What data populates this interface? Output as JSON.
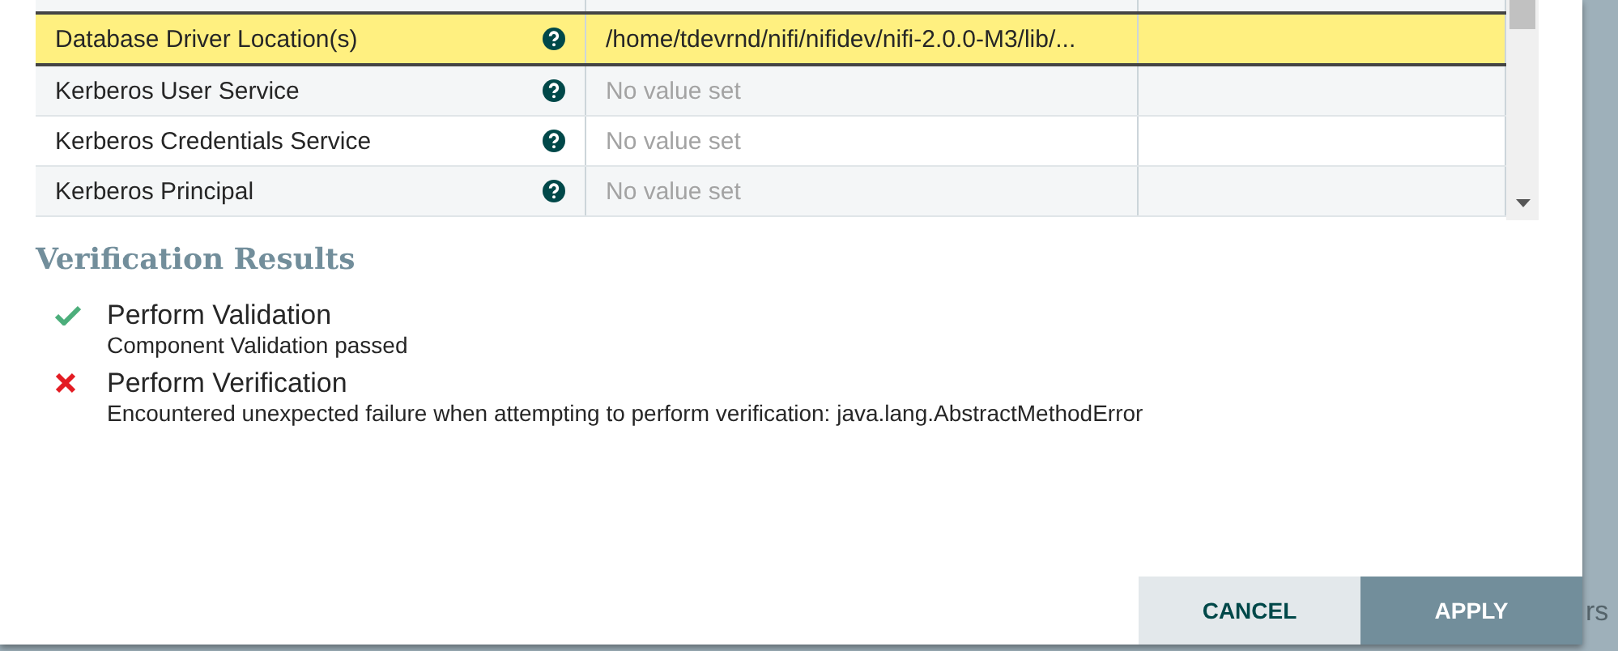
{
  "properties": {
    "rows": [
      {
        "name": "Database Driver Location(s)",
        "value": "/home/tdevrnd/nifi/nifidev/nifi-2.0.0-M3/lib/...",
        "value_set": true,
        "selected": true
      },
      {
        "name": "Kerberos User Service",
        "value": "No value set",
        "value_set": false,
        "selected": false
      },
      {
        "name": "Kerberos Credentials Service",
        "value": "No value set",
        "value_set": false,
        "selected": false
      },
      {
        "name": "Kerberos Principal",
        "value": "No value set",
        "value_set": false,
        "selected": false
      }
    ]
  },
  "verification": {
    "title": "Verification Results",
    "results": [
      {
        "kind": "passed",
        "title": "Perform Validation",
        "detail": "Component Validation passed"
      },
      {
        "kind": "failed",
        "title": "Perform Verification",
        "detail": "Encountered unexpected failure when attempting to perform verification: java.lang.AbstractMethodError"
      }
    ]
  },
  "buttons": [
    {
      "kind": "secondary",
      "label": "CANCEL"
    },
    {
      "kind": "primary",
      "label": "APPLY"
    }
  ],
  "backdrop": {
    "text": "rs"
  }
}
